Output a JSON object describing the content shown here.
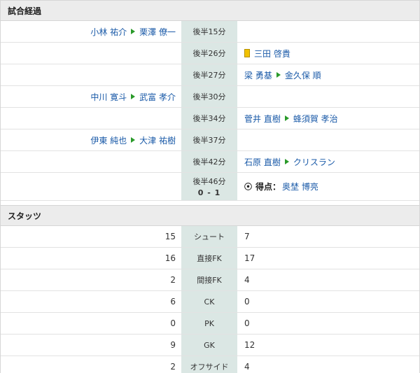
{
  "sections": {
    "progress_title": "試合経過",
    "stats_title": "スタッツ"
  },
  "events": [
    {
      "time": "後半15分",
      "left": {
        "out": "小林 祐介",
        "in": "栗澤 僚一"
      }
    },
    {
      "time": "後半26分",
      "right": {
        "card": "yellow",
        "player": "三田 啓貴"
      }
    },
    {
      "time": "後半27分",
      "right": {
        "out": "梁 勇基",
        "in": "金久保 順"
      }
    },
    {
      "time": "後半30分",
      "left": {
        "out": "中川 寛斗",
        "in": "武富 孝介"
      }
    },
    {
      "time": "後半34分",
      "right": {
        "out": "菅井 直樹",
        "in": "蜂須賀 孝治"
      }
    },
    {
      "time": "後半37分",
      "left": {
        "out": "伊東 純也",
        "in": "大津 祐樹"
      }
    },
    {
      "time": "後半42分",
      "right": {
        "out": "石原 直樹",
        "in": "クリスラン"
      }
    },
    {
      "time": "後半46分",
      "score": "0 - 1",
      "right": {
        "goal_label": "得点：",
        "player": "奥埜 博亮"
      }
    }
  ],
  "stats": [
    {
      "home": "15",
      "label": "シュート",
      "away": "7"
    },
    {
      "home": "16",
      "label": "直接FK",
      "away": "17"
    },
    {
      "home": "2",
      "label": "間接FK",
      "away": "4"
    },
    {
      "home": "6",
      "label": "CK",
      "away": "0"
    },
    {
      "home": "0",
      "label": "PK",
      "away": "0"
    },
    {
      "home": "9",
      "label": "GK",
      "away": "12"
    },
    {
      "home": "2",
      "label": "オフサイド",
      "away": "4"
    }
  ],
  "colors": {
    "link": "#1a5aa8",
    "arrow": "#2a9a2a",
    "card": "#f2c200",
    "mid_bg": "#dbe7e4"
  }
}
